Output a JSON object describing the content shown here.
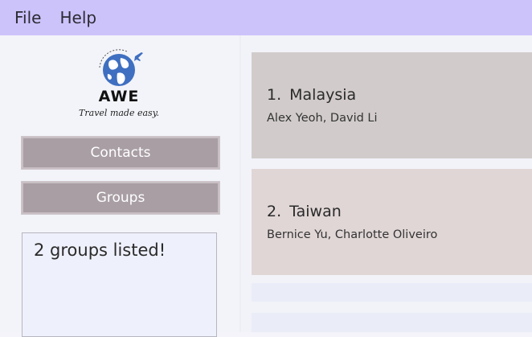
{
  "menu": {
    "file": "File",
    "help": "Help"
  },
  "logo": {
    "title": "AWE",
    "tagline": "Travel made easy."
  },
  "sidebar": {
    "buttons": [
      {
        "label": "Contacts"
      },
      {
        "label": "Groups"
      }
    ],
    "result": "2 groups listed!"
  },
  "groups": [
    {
      "index": "1.",
      "name": "Malaysia",
      "members": "Alex Yeoh, David Li"
    },
    {
      "index": "2.",
      "name": "Taiwan",
      "members": "Bernice Yu, Charlotte Oliveiro"
    }
  ],
  "colors": {
    "menubar": "#cdc3fb",
    "sidebar_button": "#a89ea4",
    "card_1": "#d1cccb",
    "card_2": "#e0d6d6",
    "globe": "#3f6fc0"
  }
}
